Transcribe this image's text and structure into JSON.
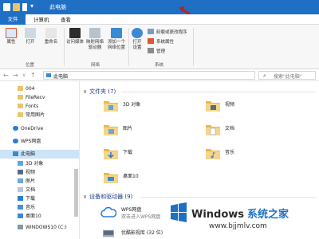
{
  "window": {
    "title": "此电脑",
    "accent": "#1f6fc5"
  },
  "ribbon_tabs": [
    "文件",
    "计算机",
    "查看"
  ],
  "ribbon": {
    "location": {
      "buttons": [
        "属性",
        "打开",
        "重命名"
      ],
      "label": "位置"
    },
    "network": {
      "buttons": [
        {
          "label": "访问媒体"
        },
        {
          "label": "映射网络",
          "line2": "驱动器"
        },
        {
          "label": "添加一个",
          "line2": "网络位置"
        }
      ],
      "label": "网络"
    },
    "system": {
      "open_settings": {
        "label": "打开",
        "line2": "设置"
      },
      "items": [
        "卸载或更改程序",
        "系统属性",
        "管理"
      ],
      "label": "系统"
    }
  },
  "address": {
    "path": "此电脑",
    "search_placeholder": "搜索\"此电脑\""
  },
  "sidebar": {
    "items": [
      {
        "label": "004",
        "icon": "folder-icon"
      },
      {
        "label": "FileRecv",
        "icon": "folder-icon"
      },
      {
        "label": "Fonts",
        "icon": "folder-icon"
      },
      {
        "label": "常用图片",
        "icon": "folder-icon"
      },
      {
        "label": "OneDrive",
        "icon": "cloud-icon"
      },
      {
        "label": "WPS网盘",
        "icon": "cloud-icon"
      },
      {
        "label": "此电脑",
        "icon": "computer-icon",
        "selected": true
      },
      {
        "label": "3D 对象",
        "icon": "3d-icon"
      },
      {
        "label": "视频",
        "icon": "video-icon"
      },
      {
        "label": "图片",
        "icon": "picture-icon"
      },
      {
        "label": "文档",
        "icon": "document-icon"
      },
      {
        "label": "下载",
        "icon": "download-icon"
      },
      {
        "label": "音乐",
        "icon": "music-icon"
      },
      {
        "label": "桌面10",
        "icon": "desktop-icon"
      },
      {
        "label": "WINDOWS10 (C:)",
        "icon": "drive-icon"
      }
    ]
  },
  "folders_section": {
    "title": "文件夹 (7)",
    "items": [
      {
        "name": "3D 对象",
        "icon": "3d-objects-folder-icon"
      },
      {
        "name": "视频",
        "icon": "videos-folder-icon"
      },
      {
        "name": "图片",
        "icon": "pictures-folder-icon"
      },
      {
        "name": "文档",
        "icon": "documents-folder-icon"
      },
      {
        "name": "下载",
        "icon": "downloads-folder-icon"
      },
      {
        "name": "音乐",
        "icon": "music-folder-icon"
      },
      {
        "name": "桌面10",
        "icon": "desktop-folder-icon"
      }
    ]
  },
  "devices_section": {
    "title": "设备和驱动器 (9)",
    "items": [
      {
        "name": "WPS网盘",
        "sub": "双击进入WPS网盘",
        "icon": "wps-cloud-icon"
      },
      {
        "name": "优酷影视库 (32 位)",
        "icon": "youku-icon"
      }
    ]
  },
  "watermark": {
    "brand": "Windows",
    "brand_sub": "系统之家",
    "url": "www.bjjmlv.com"
  }
}
